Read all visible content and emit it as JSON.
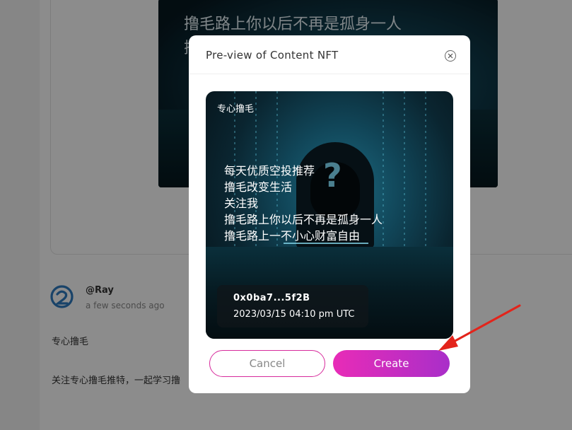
{
  "background": {
    "image_lines": [
      "撸毛路上你以后不再是孤身一人",
      "撸"
    ],
    "author": {
      "name": "@Ray",
      "time": "a few seconds ago"
    },
    "post_title": "专心撸毛",
    "post_body": "关注专心撸毛推特，一起学习撸"
  },
  "modal": {
    "title": "Pre-view of Content NFT",
    "close_icon": "close-circle-icon",
    "nft": {
      "label": "专心撸毛",
      "lines": [
        "每天优质空投推荐",
        "撸毛改变生活",
        "关注我",
        "撸毛路上你以后不再是孤身一人",
        "撸毛路上一不小心财富自由"
      ],
      "question_mark": "?",
      "address": "0x0ba7...5f2B",
      "date": "2023/03/15 04:10 pm UTC"
    },
    "cancel_label": "Cancel",
    "create_label": "Create"
  },
  "colors": {
    "accent_pink": "#e82cb7",
    "accent_purple": "#a92ec9",
    "arrow_red": "#e3241b",
    "avatar_blue": "#2e7bbf"
  }
}
